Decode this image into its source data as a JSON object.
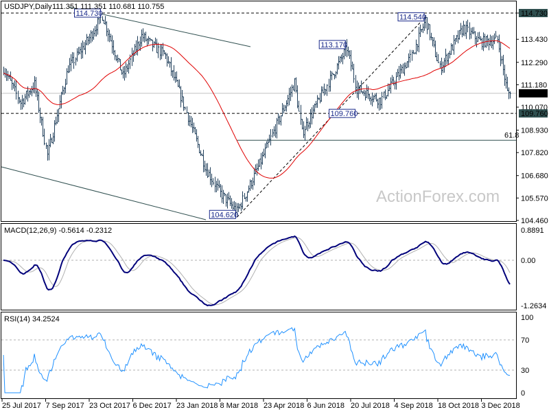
{
  "chart_data": {
    "type": "line",
    "title": "USDJPY,Daily",
    "ohlc_header": "111.351 111.351 110.681 110.755",
    "colors": {
      "bars": "#1f3e5a",
      "ma": "#e00000",
      "macd": "#00007a",
      "signal": "#b0b0b0",
      "rsi": "#1e90ff",
      "label_box": "#1a2a8a",
      "axis_tag": "#2f4f4f"
    },
    "price_axis": {
      "min": 104.46,
      "max": 114.73,
      "ticks": [
        "114.730",
        "113.430",
        "112.290",
        "111.180",
        "110.070",
        "108.930",
        "107.820",
        "106.680",
        "105.570",
        "104.460"
      ]
    },
    "current_price": "110.755",
    "level_tags": [
      "114.730",
      "109.760"
    ],
    "price_keypoints": [
      [
        0,
        112.0
      ],
      [
        12,
        110.3
      ],
      [
        22,
        111.2
      ],
      [
        31,
        107.7
      ],
      [
        46,
        112.0
      ],
      [
        61,
        113.5
      ],
      [
        70,
        114.6
      ],
      [
        85,
        111.6
      ],
      [
        98,
        113.6
      ],
      [
        115,
        112.6
      ],
      [
        124,
        111.0
      ],
      [
        144,
        107.0
      ],
      [
        154,
        105.8
      ],
      [
        166,
        104.9
      ],
      [
        183,
        107.4
      ],
      [
        207,
        111.3
      ],
      [
        212,
        108.8
      ],
      [
        227,
        110.8
      ],
      [
        244,
        113.0
      ],
      [
        251,
        111.0
      ],
      [
        268,
        110.4
      ],
      [
        290,
        112.6
      ],
      [
        300,
        114.4
      ],
      [
        310,
        112.0
      ],
      [
        327,
        114.0
      ],
      [
        339,
        113.3
      ],
      [
        351,
        113.4
      ],
      [
        358,
        110.8
      ],
      [
        360,
        110.755
      ]
    ],
    "annotations": [
      {
        "text": "114.730",
        "bar": 70,
        "price": 114.73
      },
      {
        "text": "113.170",
        "bar": 244,
        "price": 113.17
      },
      {
        "text": "114.540",
        "bar": 300,
        "price": 114.54
      },
      {
        "text": "109.760",
        "bar": 251,
        "price": 109.76
      },
      {
        "text": "104.620",
        "bar": 166,
        "price": 104.62
      }
    ],
    "fib_label": "61.8",
    "fib_level": 108.43,
    "watermark": "ActionForex.com",
    "macd": {
      "label": "MACD(12,26,9) -0.5614 -0.2312",
      "ticks": [
        "0.8891",
        "0.00",
        "-1.2634"
      ],
      "range": [
        -1.2634,
        0.8891
      ]
    },
    "rsi": {
      "label": "RSI(14) 34.2524",
      "ticks": [
        "100",
        "70",
        "30",
        "0"
      ],
      "range": [
        0,
        100
      ],
      "levels": [
        70,
        30
      ]
    },
    "x_ticks": [
      "25 Jul 2017",
      "7 Sep 2017",
      "23 Oct 2017",
      "6 Dec 2017",
      "23 Jan 2018",
      "8 Mar 2018",
      "23 Apr 2018",
      "6 Jun 2018",
      "20 Jul 2018",
      "4 Sep 2018",
      "18 Oct 2018",
      "3 Dec 2018"
    ]
  }
}
